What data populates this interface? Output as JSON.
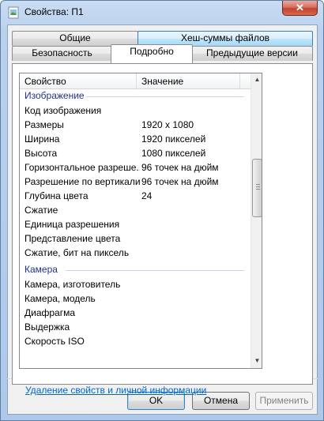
{
  "window": {
    "title": "Свойства: П1",
    "close_glyph": "✕",
    "icon": "image-file-icon"
  },
  "tabs": {
    "row1": [
      "Общие",
      "Хеш-суммы файлов"
    ],
    "row2": [
      "Безопасность",
      "Подробно",
      "Предыдущие версии"
    ],
    "active": "Подробно"
  },
  "list": {
    "headers": [
      "Свойство",
      "Значение"
    ],
    "groups": [
      {
        "label": "Изображение",
        "rows": [
          {
            "name": "Код изображения",
            "value": ""
          },
          {
            "name": "Размеры",
            "value": "1920 x 1080"
          },
          {
            "name": "Ширина",
            "value": "1920 пикселей"
          },
          {
            "name": "Высота",
            "value": "1080 пикселей"
          },
          {
            "name": "Горизонтальное разреше...",
            "value": "96 точек на дюйм"
          },
          {
            "name": "Разрешение по вертикали",
            "value": "96 точек на дюйм"
          },
          {
            "name": "Глубина цвета",
            "value": "24"
          },
          {
            "name": "Сжатие",
            "value": ""
          },
          {
            "name": "Единица разрешения",
            "value": ""
          },
          {
            "name": "Представление цвета",
            "value": ""
          },
          {
            "name": "Сжатие, бит на пиксель",
            "value": ""
          }
        ]
      },
      {
        "label": "Камера",
        "rows": [
          {
            "name": "Камера, изготовитель",
            "value": ""
          },
          {
            "name": "Камера, модель",
            "value": ""
          },
          {
            "name": "Диафрагма",
            "value": ""
          },
          {
            "name": "Выдержка",
            "value": ""
          },
          {
            "name": "Скорость ISO",
            "value": ""
          }
        ]
      }
    ],
    "scroll_up_glyph": "▲",
    "scroll_down_glyph": "▼"
  },
  "link_text": "Удаление свойств и личной информации",
  "buttons": {
    "ok": "OK",
    "cancel": "Отмена",
    "apply": "Применить"
  },
  "colors": {
    "group_header": "#1e3287",
    "link": "#0066cc",
    "close_button": "#c1432f"
  }
}
